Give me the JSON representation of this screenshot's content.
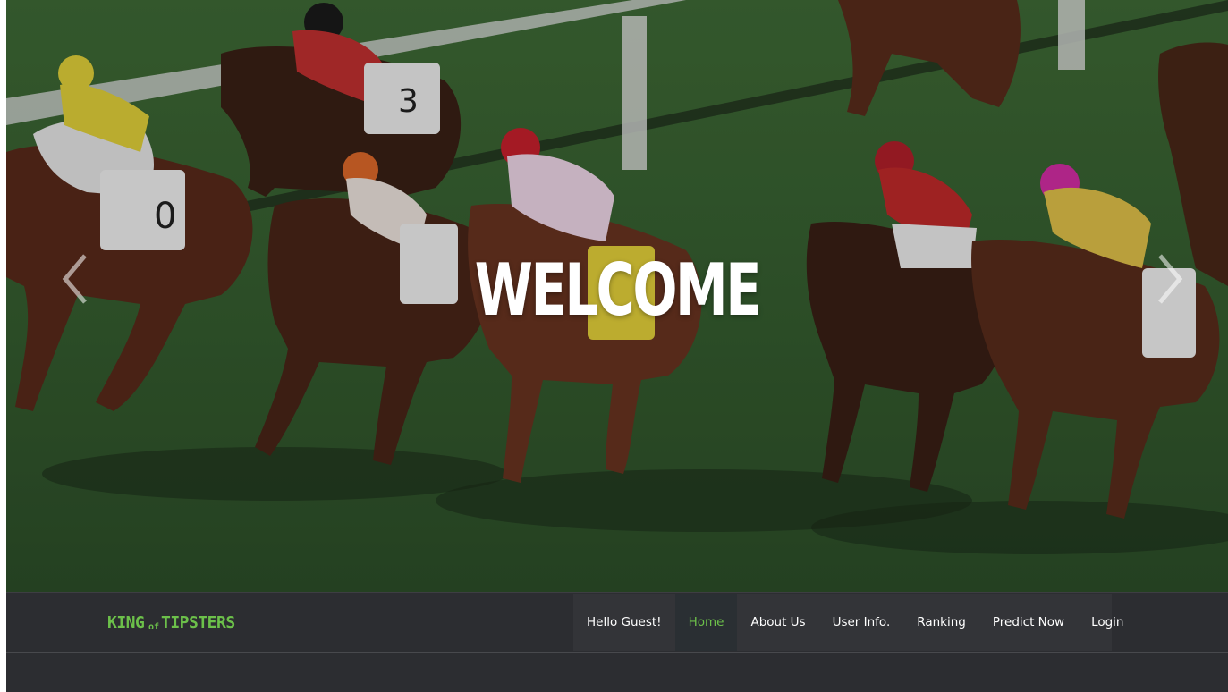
{
  "hero": {
    "heading": "WELCOME",
    "prev_icon": "chevron-left-icon",
    "next_icon": "chevron-right-icon"
  },
  "brand": {
    "logo_text": "KINGofTIPSTERS",
    "logo_color": "#6cc04a"
  },
  "nav": {
    "greeting": "Hello Guest!",
    "items": [
      {
        "label": "Home",
        "active": true
      },
      {
        "label": "About Us"
      },
      {
        "label": "User Info."
      },
      {
        "label": "Ranking"
      },
      {
        "label": "Predict Now"
      },
      {
        "label": "Login"
      }
    ]
  },
  "colors": {
    "navbar_bg": "#2c2d31",
    "menu_bg": "#333438",
    "active_text": "#6cc04a",
    "turf": "#2f4a2c"
  }
}
